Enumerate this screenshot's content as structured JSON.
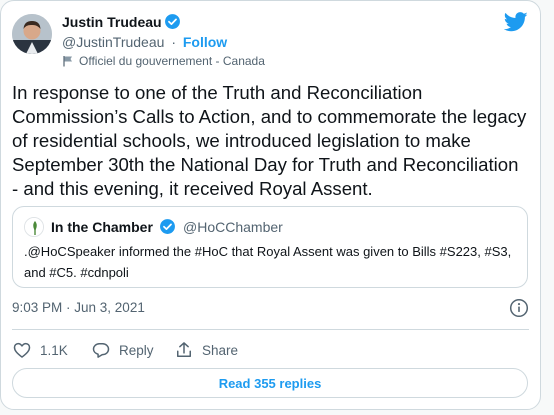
{
  "author": {
    "name": "Justin Trudeau",
    "handle": "@JustinTrudeau",
    "separator": "·",
    "follow_label": "Follow",
    "gov_label": "Officiel du gouvernement - Canada"
  },
  "tweet": {
    "text": "In response to one of the Truth and Reconciliation Commission’s Calls to Action, and to commemorate the legacy of residential schools, we introduced legislation to make September 30th the National Day for Truth and Reconciliation - and this evening, it received Royal Assent.",
    "timestamp": "9:03 PM · Jun 3, 2021"
  },
  "quote": {
    "name": "In the Chamber",
    "handle": "@HoCChamber",
    "text": ".@HoCSpeaker informed the #HoC that Royal Assent was given to Bills #S223, #S3, and #C5. #cdnpoli"
  },
  "actions": {
    "like_count": "1.1K",
    "reply_label": "Reply",
    "share_label": "Share",
    "read_replies_label": "Read 355 replies"
  },
  "colors": {
    "accent": "#1d9bf0",
    "text": "#0f1419",
    "secondary": "#536471",
    "border": "#cfd9de"
  },
  "icons": {
    "verified": "verified-badge-icon",
    "brand": "twitter-bird-icon",
    "gov": "flag-icon",
    "info": "info-icon",
    "like": "heart-icon",
    "reply": "speech-bubble-icon",
    "share": "share-arrow-icon"
  }
}
